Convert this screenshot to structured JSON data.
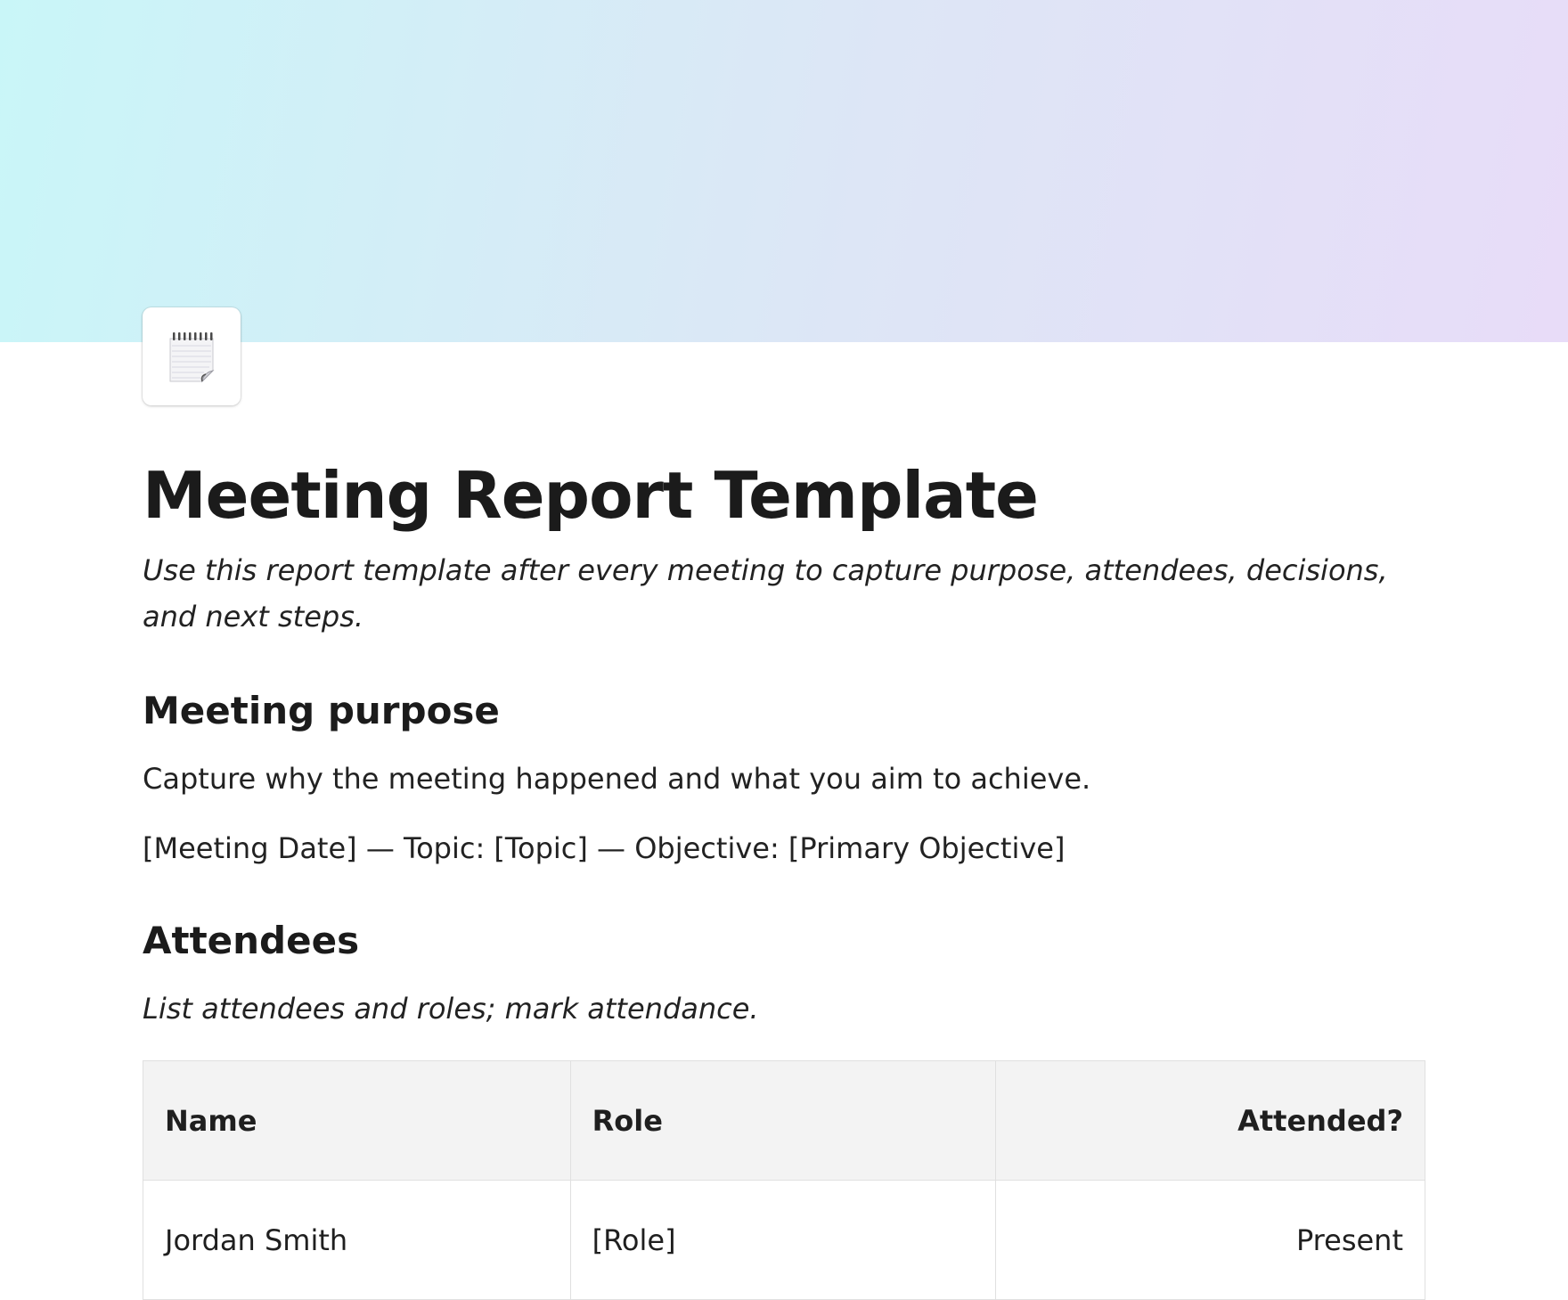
{
  "page": {
    "title": "Meeting Report Template",
    "subtitle": "Use this report template after every meeting to capture purpose, attendees, decisions, and next steps.",
    "icon": "notepad-icon"
  },
  "sections": {
    "purpose": {
      "heading": "Meeting purpose",
      "description": "Capture why the meeting happened and what you aim to achieve.",
      "details": "[Meeting Date] — Topic: [Topic] — Objective: [Primary Objective]"
    },
    "attendees": {
      "heading": "Attendees",
      "description": "List attendees and roles; mark attendance.",
      "table": {
        "headers": [
          "Name",
          "Role",
          "Attended?"
        ],
        "rows": [
          [
            "Jordan Smith",
            "[Role]",
            "Present"
          ]
        ]
      }
    }
  },
  "colors": {
    "cover_start": "#c9f6f8",
    "cover_end": "#e8dcf8",
    "header_bg": "#f3f3f3",
    "border": "#e0e0e0"
  }
}
